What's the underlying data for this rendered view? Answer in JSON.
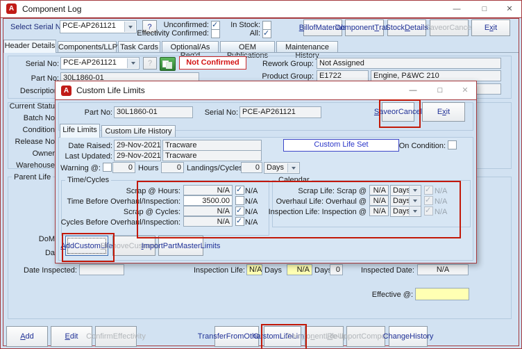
{
  "colors": {
    "accent_red": "#c21807",
    "window_border": "#a5393d",
    "background": "#d2e2f2",
    "field_yellow": "#ffffb3",
    "button_text_blue": "#1f3096",
    "badge_red": "#d41414",
    "custom_life_blue": "#2a35c8"
  },
  "icons": {
    "app": "A",
    "minimize": "—",
    "maximize": "□",
    "close": "✕",
    "help": "?"
  },
  "main": {
    "title": "Component Log",
    "toolbar": {
      "select_serial_label": "Select Serial No:",
      "serial_value": "PCE-AP261121",
      "help": "?",
      "unconfirmed_label": "Unconfirmed:",
      "unconfirmed_checked": true,
      "effectivity_label": "Effectivity Confirmed:",
      "effectivity_checked": false,
      "in_stock_label": "In Stock:",
      "in_stock_checked": false,
      "all_label": "All:",
      "all_checked": true,
      "buttons": [
        {
          "label": "Bill of\nMaterials",
          "u": 0
        },
        {
          "label": "Component\nTrace",
          "u": 10
        },
        {
          "label": "Stock\nDetails",
          "u": 6
        },
        {
          "label": "Save or\nCancel",
          "disabled": true
        },
        {
          "label": "Exit",
          "u": 1
        }
      ]
    },
    "tabs": [
      {
        "label": "Header Details",
        "active": true
      },
      {
        "label": "Components/LLP's"
      },
      {
        "label": "Task Cards"
      },
      {
        "label": "Optional/As Req'd"
      },
      {
        "label": "OEM Publications"
      },
      {
        "label": "Maintenance History"
      }
    ],
    "header": {
      "serial_label": "Serial No:",
      "serial_value": "PCE-AP261121",
      "help": "?",
      "status_badge": "Not Confirmed",
      "rework_label": "Rework Group:",
      "rework_value": "Not Assigned",
      "part_label": "Part No:",
      "part_value": "30L1860-01",
      "product_label": "Product Group:",
      "product_code": "E1722",
      "product_desc": "Engine, P&WC 210",
      "description_label": "Description:"
    },
    "left_labels": [
      "Current Statu",
      "Batch No",
      "Condition",
      "Release No",
      "Owner",
      "Warehouse"
    ],
    "parent_life_label": "Parent Life",
    "dom_fragment": "DoM",
    "da_fragment": "Da",
    "inspection_row": {
      "date_inspected_label": "Date Inspected:",
      "inspection_life_label": "Inspection Life:",
      "life_value1": "N/A",
      "days1": "Days",
      "life_value2": "N/A",
      "days2": "Days",
      "cycles_value": "0",
      "inspected_date_label": "Inspected Date:",
      "inspected_date_value": "N/A"
    },
    "effective_label": "Effective @:",
    "bottom_buttons": [
      {
        "label": "Add",
        "u": 0
      },
      {
        "label": "Edit",
        "u": 0
      },
      {
        "label": "Confirm\nEffectivity",
        "disabled": true
      },
      {
        "label": "Transfer From\nOther S/N"
      },
      {
        "label": "Custom\nLife Limits",
        "highlight": true
      },
      {
        "label": "Component\nLife Update",
        "u": 5,
        "disabled": true
      },
      {
        "label": "Re-Import\nComponents",
        "u": 0,
        "disabled": true
      },
      {
        "label": "Change\nHistory"
      }
    ]
  },
  "dlg": {
    "title": "Custom Life Limits",
    "part_label": "Part No:",
    "part_value": "30L1860-01",
    "serial_label": "Serial No:",
    "serial_value": "PCE-AP261121",
    "btn_save": {
      "label": "Save or\nCancel",
      "u": 0,
      "highlight": true
    },
    "btn_exit": {
      "label": "Exit",
      "u": 1
    },
    "tab1": "Life Limits",
    "tab2": "Custom Life History",
    "date_raised_label": "Date Raised:",
    "date_raised": "29-Nov-2021",
    "raised_by": "Tracware",
    "last_updated_label": "Last Updated:",
    "last_updated": "29-Nov-2021",
    "updated_by": "Tracware",
    "custom_life_set": "Custom Life Set",
    "on_condition_label": "On Condition:",
    "on_condition_checked": false,
    "warning_label": "Warning @:",
    "warning_checked": false,
    "w_hours": "0",
    "hours_label": "Hours",
    "w_landings": "0",
    "landings_label": "Landings/Cycles",
    "w_days": "0",
    "days_unit": "Days",
    "tc_label": "Time/Cycles",
    "tc_rows": [
      {
        "label": "Scrap @ Hours:",
        "value": "N/A",
        "na": "N/A",
        "checked": true,
        "editable": false
      },
      {
        "label": "Time Before Overhaul/Inspection:",
        "value": "3500.00",
        "na": "N/A",
        "checked": false,
        "editable": true
      },
      {
        "label": "Scrap @ Cycles:",
        "value": "N/A",
        "na": "N/A",
        "checked": true,
        "editable": false
      },
      {
        "label": "Cycles Before Overhaul/Inspection:",
        "value": "N/A",
        "na": "N/A",
        "checked": true,
        "editable": false
      }
    ],
    "cal_label": "Calendar",
    "cal_rows": [
      {
        "label": "Scrap Life: Scrap @",
        "value": "N/A",
        "unit": "Days",
        "na": "N/A",
        "checked": true
      },
      {
        "label": "Overhaul Life: Overhaul @",
        "value": "N/A",
        "unit": "Days",
        "na": "N/A",
        "checked": true
      },
      {
        "label": "Inspection Life: Inspection @",
        "value": "N/A",
        "unit": "Days",
        "na": "N/A",
        "checked": true
      }
    ],
    "btn_add": {
      "label": "Add\nCustom Life",
      "u": 0,
      "highlight": true,
      "focus": true
    },
    "btn_remove": {
      "label": "Remove\nCustom Life",
      "u": 0,
      "disabled": true
    },
    "btn_import": {
      "label": "Import Part\nMaster Limits",
      "u": 0
    }
  }
}
